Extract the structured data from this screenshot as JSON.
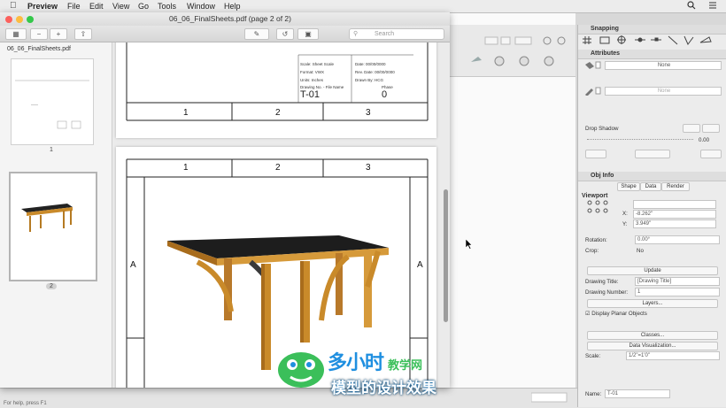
{
  "menubar": {
    "app_name": "Preview",
    "items": [
      "File",
      "Edit",
      "View",
      "Go",
      "Tools",
      "Window",
      "Help"
    ]
  },
  "window": {
    "title": "06_06_FinalSheets.pdf (page 2 of 2)",
    "search_placeholder": "Search"
  },
  "sidebar": {
    "file_name": "06_06_FinalSheets.pdf",
    "pages": [
      "1",
      "2"
    ],
    "selected_page": "2"
  },
  "document": {
    "page1_columns": [
      "1",
      "2",
      "3"
    ],
    "page2_columns": [
      "1",
      "2",
      "3"
    ],
    "row_label": "A",
    "title_block": {
      "sheet_scale_label": "Scale: Sheet Scale",
      "format_label": "Format: VWX",
      "units_label": "Units: Inches",
      "date_label": "Date: 00/00/0000",
      "rev_date_label": "Rev. Date: 00/00/0000",
      "drawn_by_label": "Drawn By: HCG",
      "drawing_no_label": "Drawing No. - File Name",
      "phase_label": "Phase",
      "sheet_number": "T-01",
      "phase_value": "0"
    }
  },
  "palettes": {
    "snapping_title": "Snapping",
    "attributes_title": "Attributes",
    "fill_value": "None",
    "pen_value": "None",
    "drop_shadow_label": "Drop Shadow",
    "shadow_value": "0.00",
    "obj_info_title": "Obj Info",
    "tabs": [
      "Shape",
      "Data",
      "Render"
    ],
    "object_type": "Viewport",
    "x_label": "X:",
    "x_value": "-8.262\"",
    "y_label": "Y:",
    "y_value": "3.949\"",
    "rotation_label": "Rotation:",
    "rotation_value": "0.00°",
    "crop_label": "Crop:",
    "crop_value": "No",
    "update_button": "Update",
    "drawing_title_label": "Drawing Title:",
    "drawing_title_value": "[Drawing Title]",
    "drawing_number_label": "Drawing Number:",
    "drawing_number_value": "1",
    "layers_button": "Layers...",
    "display_planar_label": "Display Planar Objects",
    "classes_button": "Classes...",
    "data_viz_button": "Data Visualization...",
    "scale_label": "Scale:",
    "scale_value": "1/2\"=1'0\"",
    "name_label": "Name:",
    "name_value": "T-01"
  },
  "status_bar": {
    "left_text": "For help, press F1"
  },
  "watermark": {
    "line1": "多小时",
    "line2": "教学网",
    "line3": "模型的设计效果"
  },
  "colors": {
    "traffic_red": "#fc605c",
    "traffic_yellow": "#fdbc40",
    "traffic_green": "#34c84a",
    "wm_green": "#3bbf5a",
    "wm_blue": "#1f8fe0",
    "table_wood": "#c98a2a"
  }
}
